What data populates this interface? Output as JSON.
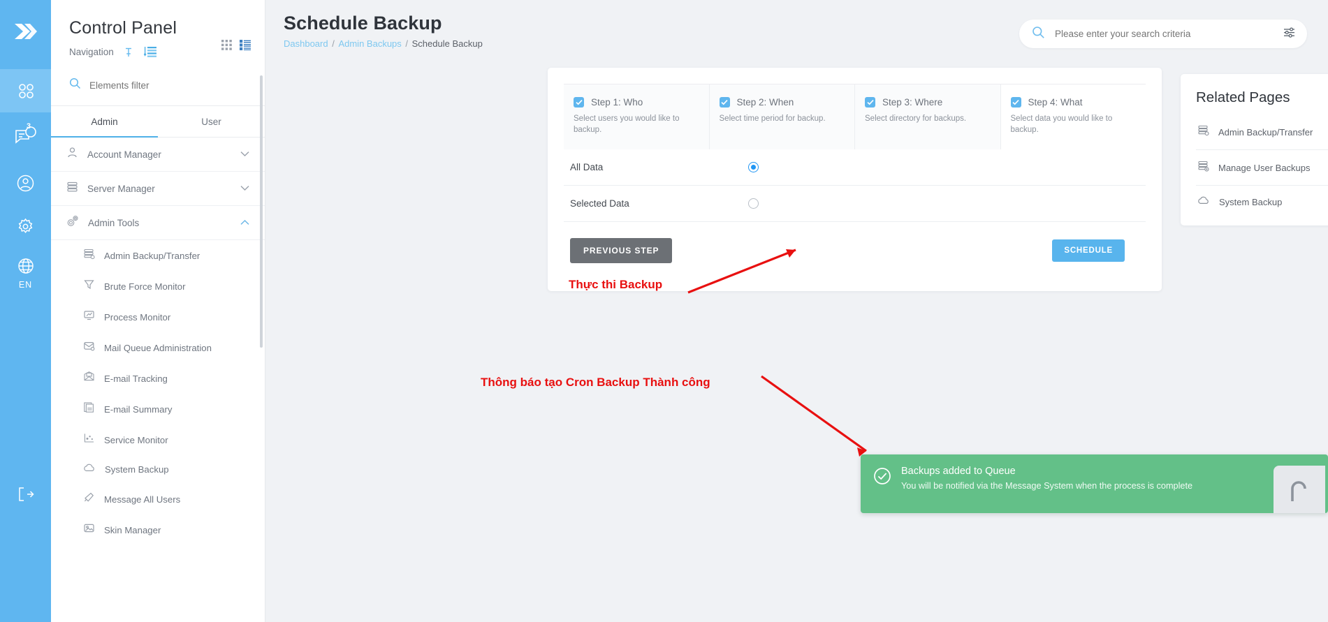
{
  "rail": {
    "logo_icon": "chevrons-right-icon",
    "items": [
      {
        "icon": "apps-grid-icon",
        "name": "apps"
      },
      {
        "icon": "chat-bubble-icon",
        "name": "messages",
        "badge": "3"
      },
      {
        "icon": "user-circle-icon",
        "name": "account"
      },
      {
        "icon": "gear-icon",
        "name": "settings"
      },
      {
        "icon": "globe-icon",
        "name": "language"
      }
    ],
    "language_label": "EN",
    "logout_icon": "logout-icon"
  },
  "sidebar": {
    "title": "Control Panel",
    "nav_label": "Navigation",
    "pin_icon": "pin-icon",
    "sort_icon": "sort-list-icon",
    "view_grid_icon": "grid-view-icon",
    "view_list_icon": "list-view-icon",
    "filter_placeholder": "Elements filter",
    "filter_value": "",
    "search_icon": "search-icon",
    "tabs": [
      {
        "label": "Admin",
        "active": true
      },
      {
        "label": "User",
        "active": false
      }
    ],
    "groups": [
      {
        "label": "Account Manager",
        "icon": "user-icon",
        "expanded": false
      },
      {
        "label": "Server Manager",
        "icon": "server-icon",
        "expanded": false
      },
      {
        "label": "Admin Tools",
        "icon": "gears-icon",
        "expanded": true
      }
    ],
    "items": [
      {
        "label": "Admin Backup/Transfer",
        "icon": "server-backup-icon"
      },
      {
        "label": "Brute Force Monitor",
        "icon": "funnel-icon"
      },
      {
        "label": "Process Monitor",
        "icon": "monitor-chart-icon"
      },
      {
        "label": "Mail Queue Administration",
        "icon": "mail-queue-icon"
      },
      {
        "label": "E-mail Tracking",
        "icon": "mail-track-icon"
      },
      {
        "label": "E-mail Summary",
        "icon": "mail-summary-icon"
      },
      {
        "label": "Service Monitor",
        "icon": "service-monitor-icon"
      },
      {
        "label": "System Backup",
        "icon": "cloud-icon"
      },
      {
        "label": "Message All Users",
        "icon": "megaphone-icon"
      },
      {
        "label": "Skin Manager",
        "icon": "image-icon"
      }
    ]
  },
  "header": {
    "title": "Schedule Backup",
    "breadcrumb": [
      {
        "label": "Dashboard",
        "link": true
      },
      {
        "label": "Admin Backups",
        "link": true
      },
      {
        "label": "Schedule Backup",
        "link": false
      }
    ],
    "search_placeholder": "Please enter your search criteria",
    "search_value": "",
    "search_icon": "search-icon",
    "filter_icon": "sliders-icon"
  },
  "wizard": {
    "steps": [
      {
        "title": "Step 1: Who",
        "desc": "Select users you would like to backup.",
        "checked": true
      },
      {
        "title": "Step 2: When",
        "desc": "Select time period for backup.",
        "checked": true
      },
      {
        "title": "Step 3: Where",
        "desc": "Select directory for backups.",
        "checked": true
      },
      {
        "title": "Step 4: What",
        "desc": "Select data you would like to backup.",
        "checked": true
      }
    ],
    "options": [
      {
        "label": "All Data",
        "selected": true
      },
      {
        "label": "Selected Data",
        "selected": false
      }
    ],
    "previous_label": "PREVIOUS STEP",
    "schedule_label": "SCHEDULE"
  },
  "related": {
    "title": "Related Pages",
    "items": [
      {
        "label": "Admin Backup/Transfer",
        "icon": "server-backup-icon"
      },
      {
        "label": "Manage User Backups",
        "icon": "server-users-icon"
      },
      {
        "label": "System Backup",
        "icon": "cloud-icon"
      }
    ]
  },
  "annotations": [
    {
      "text": "Thực thi Backup",
      "color": "#e81010"
    },
    {
      "text": "Thông báo tạo Cron Backup Thành công",
      "color": "#e81010"
    }
  ],
  "toast": {
    "title": "Backups added to Queue",
    "body": "You will be notified via the Message System when the process is complete",
    "icon": "check-circle-icon",
    "color": "#63c088"
  }
}
